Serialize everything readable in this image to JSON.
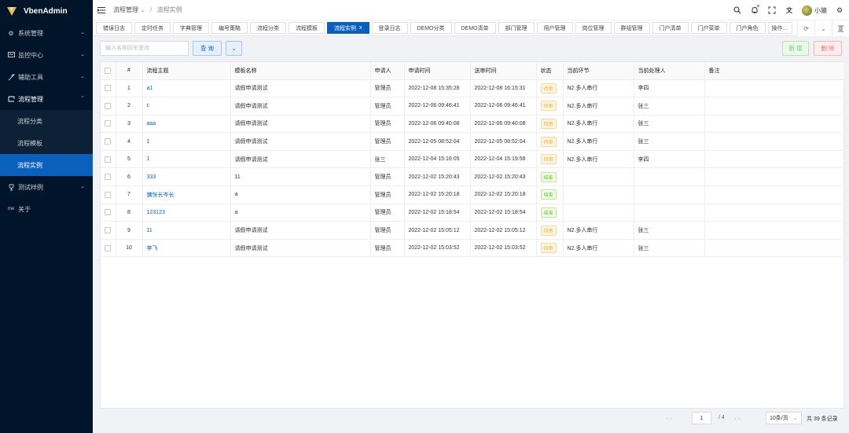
{
  "app": {
    "title": "VbenAdmin"
  },
  "sidebar": {
    "items": [
      {
        "label": "系统管理",
        "icon": "gear-icon"
      },
      {
        "label": "监控中心",
        "icon": "monitor-icon"
      },
      {
        "label": "辅助工具",
        "icon": "tool-icon"
      },
      {
        "label": "流程管理",
        "icon": "workflow-icon",
        "open": true
      },
      {
        "label": "测试样例",
        "icon": "trophy-icon"
      },
      {
        "label": "关于",
        "icon": "info-icon"
      }
    ],
    "sub_items": [
      {
        "label": "流程分类"
      },
      {
        "label": "流程模板"
      },
      {
        "label": "流程实例",
        "active": true
      }
    ]
  },
  "header": {
    "breadcrumb": [
      "流程管理",
      "流程实例"
    ],
    "user": "小猿"
  },
  "tabs": [
    {
      "label": "错误日志"
    },
    {
      "label": "定时任务"
    },
    {
      "label": "字典管理"
    },
    {
      "label": "编号策略"
    },
    {
      "label": "流程分类"
    },
    {
      "label": "流程模板"
    },
    {
      "label": "流程实例",
      "active": true,
      "close": "x"
    },
    {
      "label": "登录日志"
    },
    {
      "label": "DEMO分类"
    },
    {
      "label": "DEMO清单"
    },
    {
      "label": "部门管理"
    },
    {
      "label": "用户管理"
    },
    {
      "label": "岗位管理"
    },
    {
      "label": "群组管理"
    },
    {
      "label": "门户清单"
    },
    {
      "label": "门户菜单"
    },
    {
      "label": "门户角色"
    },
    {
      "label": "操作…"
    }
  ],
  "toolbar": {
    "search_placeholder": "输入名称回车查询",
    "query_label": "查 询",
    "add_label": "新 增",
    "delete_label": "删 除"
  },
  "table": {
    "columns": [
      "#",
      "流程主题",
      "模板名称",
      "申请人",
      "申请时间",
      "送审时间",
      "状态",
      "当前环节",
      "当前处理人",
      "备注"
    ],
    "rows": [
      {
        "idx": "1",
        "subject": "a1",
        "template": "请假申请测试",
        "applicant": "管理员",
        "apply_time": "2022-12-08 15:35:28",
        "submit_time": "2022-12-08 16:15:31",
        "status": "待审",
        "status_type": "pending",
        "step": "N2.多人串行",
        "handler": "李四",
        "note": ""
      },
      {
        "idx": "2",
        "subject": "c",
        "template": "请假申请测试",
        "applicant": "管理员",
        "apply_time": "2022-12-06 09:46:41",
        "submit_time": "2022-12-06 09:46:41",
        "status": "待审",
        "status_type": "pending",
        "step": "N2.多人串行",
        "handler": "张三",
        "note": ""
      },
      {
        "idx": "3",
        "subject": "aaa",
        "template": "请假申请测试",
        "applicant": "管理员",
        "apply_time": "2022-12-06 09:40:08",
        "submit_time": "2022-12-06 09:40:08",
        "status": "待审",
        "status_type": "pending",
        "step": "N2.多人串行",
        "handler": "张三",
        "note": ""
      },
      {
        "idx": "4",
        "subject": "1",
        "template": "请假申请测试",
        "applicant": "管理员",
        "apply_time": "2022-12-05 08:52:04",
        "submit_time": "2022-12-05 08:52:04",
        "status": "待审",
        "status_type": "pending",
        "step": "N2.多人串行",
        "handler": "张三",
        "note": ""
      },
      {
        "idx": "5",
        "subject": "1",
        "template": "请假申请测试",
        "applicant": "张三",
        "apply_time": "2022-12-04 15:16:05",
        "submit_time": "2022-12-04 15:19:56",
        "status": "待审",
        "status_type": "pending",
        "step": "N2.多人串行",
        "handler": "李四",
        "note": ""
      },
      {
        "idx": "6",
        "subject": "333",
        "template": "11",
        "applicant": "管理员",
        "apply_time": "2022-12-02 15:20:43",
        "submit_time": "2022-12-02 15:20:43",
        "status": "结束",
        "status_type": "done",
        "step": "",
        "handler": "",
        "note": ""
      },
      {
        "idx": "7",
        "subject": "慵怅长岑长",
        "template": "a",
        "applicant": "管理员",
        "apply_time": "2022-12-02 15:20:18",
        "submit_time": "2022-12-02 15:20:18",
        "status": "结束",
        "status_type": "done",
        "step": "",
        "handler": "",
        "note": ""
      },
      {
        "idx": "8",
        "subject": "123123",
        "template": "a",
        "applicant": "管理员",
        "apply_time": "2022-12-02 15:18:54",
        "submit_time": "2022-12-02 15:18:54",
        "status": "结束",
        "status_type": "done",
        "step": "",
        "handler": "",
        "note": ""
      },
      {
        "idx": "9",
        "subject": "11",
        "template": "请假申请测试",
        "applicant": "管理员",
        "apply_time": "2022-12-02 15:05:12",
        "submit_time": "2022-12-02 15:05:12",
        "status": "待审",
        "status_type": "pending",
        "step": "N2.多人串行",
        "handler": "张三",
        "note": ""
      },
      {
        "idx": "10",
        "subject": "李飞",
        "template": "请假申请测试",
        "applicant": "管理员",
        "apply_time": "2022-12-02 15:03:52",
        "submit_time": "2022-12-02 15:03:52",
        "status": "待审",
        "status_type": "pending",
        "step": "N2.多人串行",
        "handler": "张三",
        "note": ""
      }
    ]
  },
  "pagination": {
    "current_page": "1",
    "total_pages": "/ 4",
    "page_size": "10条/页",
    "total_text": "共 39 条记录"
  },
  "colors": {
    "sidebar_bg": "#001529",
    "primary": "#0960bd",
    "success": "#55d187",
    "danger": "#ed6f6f",
    "warning": "#f5a623"
  }
}
